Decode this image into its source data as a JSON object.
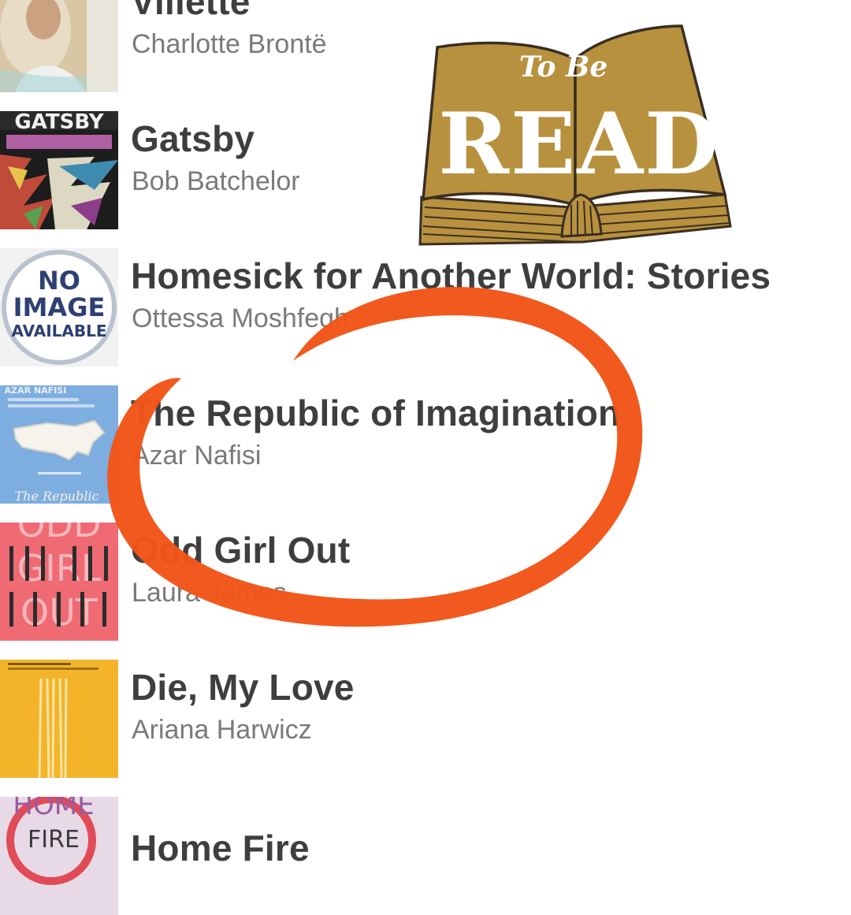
{
  "books": [
    {
      "title": "Villette",
      "author": "Charlotte Brontë",
      "cover_icon": "villette-cover"
    },
    {
      "title": "Gatsby",
      "author": "Bob Batchelor",
      "cover_icon": "gatsby-cover"
    },
    {
      "title": "Homesick for Another World: Stories",
      "author": "Ottessa Moshfegh",
      "cover_icon": "no-image-cover"
    },
    {
      "title": "The Republic of Imagination",
      "author": "Azar Nafisi",
      "cover_icon": "republic-cover"
    },
    {
      "title": "Odd Girl Out",
      "author": "Laura James",
      "cover_icon": "odd-girl-out-cover"
    },
    {
      "title": "Die, My Love",
      "author": "Ariana Harwicz",
      "cover_icon": "die-my-love-cover"
    },
    {
      "title": "Home Fire",
      "author": "",
      "cover_icon": "home-fire-cover"
    }
  ],
  "covers": {
    "gatsby_text": "GATSBY",
    "no_image": [
      "NO",
      "IMAGE",
      "AVAILABLE"
    ],
    "republic_author": "AZAR NAFISI",
    "republic_script": "The Republic",
    "odd_girl_out": [
      "ODD",
      "GIRL",
      "OUT"
    ],
    "home_fire": [
      "HOME",
      "FIRE"
    ]
  },
  "badge": {
    "line1": "To Be",
    "line2": "READ",
    "colors": {
      "book": "#b8913e",
      "outline": "#3a2e22",
      "text": "#ffffff"
    }
  },
  "highlight": {
    "color": "#f25417",
    "icon": "hand-drawn-circle"
  }
}
